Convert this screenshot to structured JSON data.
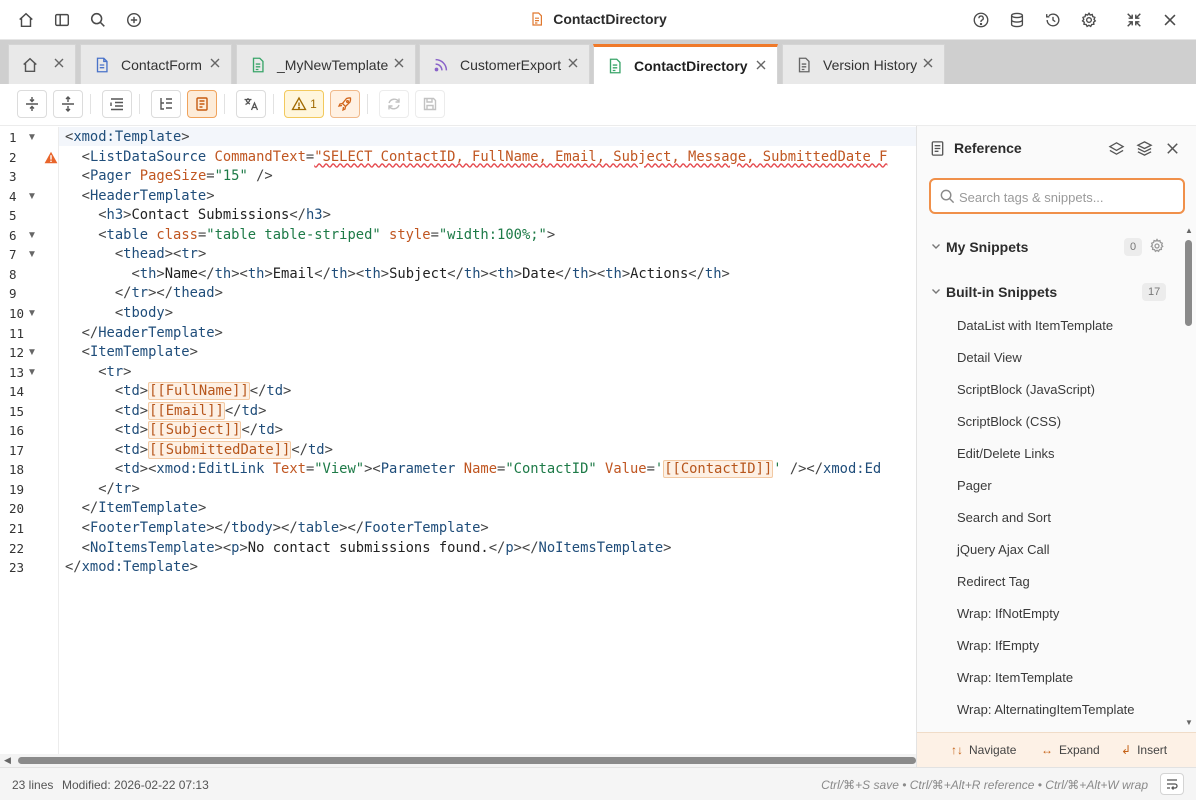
{
  "window": {
    "title": "ContactDirectory"
  },
  "tabs": [
    {
      "label": "",
      "icon": "home-icon"
    },
    {
      "label": "ContactForm",
      "icon": "document-icon"
    },
    {
      "label": "_MyNewTemplate",
      "icon": "template-icon"
    },
    {
      "label": "CustomerExport",
      "icon": "rss-icon"
    },
    {
      "label": "ContactDirectory",
      "icon": "template-icon",
      "active": true
    },
    {
      "label": "Version History",
      "icon": "history-document-icon"
    }
  ],
  "toolbar": {
    "warning_count": "1"
  },
  "editor": {
    "line_numbers": [
      "1",
      "2",
      "3",
      "4",
      "5",
      "6",
      "7",
      "8",
      "9",
      "10",
      "11",
      "12",
      "13",
      "14",
      "15",
      "16",
      "17",
      "18",
      "19",
      "20",
      "21",
      "22",
      "23"
    ],
    "foldable_lines": [
      1,
      4,
      6,
      7,
      10,
      12,
      13
    ],
    "warning_line": 2,
    "lines": [
      [
        [
          "br",
          "<"
        ],
        [
          "tag",
          "xmod:Template"
        ],
        [
          "br",
          ">"
        ]
      ],
      [
        [
          "txt",
          "  "
        ],
        [
          "br",
          "<"
        ],
        [
          "tag",
          "ListDataSource"
        ],
        [
          "txt",
          " "
        ],
        [
          "attr",
          "CommandText"
        ],
        [
          "br",
          "="
        ],
        [
          "sq",
          "\"SELECT ContactID, FullName, Email, Subject, Message, SubmittedDate F"
        ]
      ],
      [
        [
          "txt",
          "  "
        ],
        [
          "br",
          "<"
        ],
        [
          "tag",
          "Pager"
        ],
        [
          "txt",
          " "
        ],
        [
          "attr",
          "PageSize"
        ],
        [
          "br",
          "="
        ],
        [
          "str",
          "\"15\""
        ],
        [
          "txt",
          " "
        ],
        [
          "br",
          "/>"
        ]
      ],
      [
        [
          "txt",
          "  "
        ],
        [
          "br",
          "<"
        ],
        [
          "tag",
          "HeaderTemplate"
        ],
        [
          "br",
          ">"
        ]
      ],
      [
        [
          "txt",
          "    "
        ],
        [
          "br",
          "<"
        ],
        [
          "tag",
          "h3"
        ],
        [
          "br",
          ">"
        ],
        [
          "txt",
          "Contact Submissions"
        ],
        [
          "br",
          "</"
        ],
        [
          "tag",
          "h3"
        ],
        [
          "br",
          ">"
        ]
      ],
      [
        [
          "txt",
          "    "
        ],
        [
          "br",
          "<"
        ],
        [
          "tag",
          "table"
        ],
        [
          "txt",
          " "
        ],
        [
          "attr",
          "class"
        ],
        [
          "br",
          "="
        ],
        [
          "str",
          "\"table table-striped\""
        ],
        [
          "txt",
          " "
        ],
        [
          "attr",
          "style"
        ],
        [
          "br",
          "="
        ],
        [
          "str",
          "\"width:100%;\""
        ],
        [
          "br",
          ">"
        ]
      ],
      [
        [
          "txt",
          "      "
        ],
        [
          "br",
          "<"
        ],
        [
          "tag",
          "thead"
        ],
        [
          "br",
          "><"
        ],
        [
          "tag",
          "tr"
        ],
        [
          "br",
          ">"
        ]
      ],
      [
        [
          "txt",
          "        "
        ],
        [
          "br",
          "<"
        ],
        [
          "tag",
          "th"
        ],
        [
          "br",
          ">"
        ],
        [
          "txt",
          "Name"
        ],
        [
          "br",
          "</"
        ],
        [
          "tag",
          "th"
        ],
        [
          "br",
          "><"
        ],
        [
          "tag",
          "th"
        ],
        [
          "br",
          ">"
        ],
        [
          "txt",
          "Email"
        ],
        [
          "br",
          "</"
        ],
        [
          "tag",
          "th"
        ],
        [
          "br",
          "><"
        ],
        [
          "tag",
          "th"
        ],
        [
          "br",
          ">"
        ],
        [
          "txt",
          "Subject"
        ],
        [
          "br",
          "</"
        ],
        [
          "tag",
          "th"
        ],
        [
          "br",
          "><"
        ],
        [
          "tag",
          "th"
        ],
        [
          "br",
          ">"
        ],
        [
          "txt",
          "Date"
        ],
        [
          "br",
          "</"
        ],
        [
          "tag",
          "th"
        ],
        [
          "br",
          "><"
        ],
        [
          "tag",
          "th"
        ],
        [
          "br",
          ">"
        ],
        [
          "txt",
          "Actions"
        ],
        [
          "br",
          "</"
        ],
        [
          "tag",
          "th"
        ],
        [
          "br",
          ">"
        ]
      ],
      [
        [
          "txt",
          "      "
        ],
        [
          "br",
          "</"
        ],
        [
          "tag",
          "tr"
        ],
        [
          "br",
          "></"
        ],
        [
          "tag",
          "thead"
        ],
        [
          "br",
          ">"
        ]
      ],
      [
        [
          "txt",
          "      "
        ],
        [
          "br",
          "<"
        ],
        [
          "tag",
          "tbody"
        ],
        [
          "br",
          ">"
        ]
      ],
      [
        [
          "txt",
          "  "
        ],
        [
          "br",
          "</"
        ],
        [
          "tag",
          "HeaderTemplate"
        ],
        [
          "br",
          ">"
        ]
      ],
      [
        [
          "txt",
          "  "
        ],
        [
          "br",
          "<"
        ],
        [
          "tag",
          "ItemTemplate"
        ],
        [
          "br",
          ">"
        ]
      ],
      [
        [
          "txt",
          "    "
        ],
        [
          "br",
          "<"
        ],
        [
          "tag",
          "tr"
        ],
        [
          "br",
          ">"
        ]
      ],
      [
        [
          "txt",
          "      "
        ],
        [
          "br",
          "<"
        ],
        [
          "tag",
          "td"
        ],
        [
          "br",
          ">"
        ],
        [
          "tok",
          "[[FullName]]"
        ],
        [
          "br",
          "</"
        ],
        [
          "tag",
          "td"
        ],
        [
          "br",
          ">"
        ]
      ],
      [
        [
          "txt",
          "      "
        ],
        [
          "br",
          "<"
        ],
        [
          "tag",
          "td"
        ],
        [
          "br",
          ">"
        ],
        [
          "tok",
          "[[Email]]"
        ],
        [
          "br",
          "</"
        ],
        [
          "tag",
          "td"
        ],
        [
          "br",
          ">"
        ]
      ],
      [
        [
          "txt",
          "      "
        ],
        [
          "br",
          "<"
        ],
        [
          "tag",
          "td"
        ],
        [
          "br",
          ">"
        ],
        [
          "tok",
          "[[Subject]]"
        ],
        [
          "br",
          "</"
        ],
        [
          "tag",
          "td"
        ],
        [
          "br",
          ">"
        ]
      ],
      [
        [
          "txt",
          "      "
        ],
        [
          "br",
          "<"
        ],
        [
          "tag",
          "td"
        ],
        [
          "br",
          ">"
        ],
        [
          "tok",
          "[[SubmittedDate]]"
        ],
        [
          "br",
          "</"
        ],
        [
          "tag",
          "td"
        ],
        [
          "br",
          ">"
        ]
      ],
      [
        [
          "txt",
          "      "
        ],
        [
          "br",
          "<"
        ],
        [
          "tag",
          "td"
        ],
        [
          "br",
          "><"
        ],
        [
          "tag",
          "xmod:EditLink"
        ],
        [
          "txt",
          " "
        ],
        [
          "attr",
          "Text"
        ],
        [
          "br",
          "="
        ],
        [
          "str",
          "\"View\""
        ],
        [
          "br",
          "><"
        ],
        [
          "tag",
          "Parameter"
        ],
        [
          "txt",
          " "
        ],
        [
          "attr",
          "Name"
        ],
        [
          "br",
          "="
        ],
        [
          "str",
          "\"ContactID\""
        ],
        [
          "txt",
          " "
        ],
        [
          "attr",
          "Value"
        ],
        [
          "br",
          "="
        ],
        [
          "str",
          "'"
        ],
        [
          "tok",
          "[[ContactID]]"
        ],
        [
          "str",
          "'"
        ],
        [
          "txt",
          " "
        ],
        [
          "br",
          "/></"
        ],
        [
          "tag",
          "xmod:Ed"
        ]
      ],
      [
        [
          "txt",
          "    "
        ],
        [
          "br",
          "</"
        ],
        [
          "tag",
          "tr"
        ],
        [
          "br",
          ">"
        ]
      ],
      [
        [
          "txt",
          "  "
        ],
        [
          "br",
          "</"
        ],
        [
          "tag",
          "ItemTemplate"
        ],
        [
          "br",
          ">"
        ]
      ],
      [
        [
          "txt",
          "  "
        ],
        [
          "br",
          "<"
        ],
        [
          "tag",
          "FooterTemplate"
        ],
        [
          "br",
          "></"
        ],
        [
          "tag",
          "tbody"
        ],
        [
          "br",
          "></"
        ],
        [
          "tag",
          "table"
        ],
        [
          "br",
          "></"
        ],
        [
          "tag",
          "FooterTemplate"
        ],
        [
          "br",
          ">"
        ]
      ],
      [
        [
          "txt",
          "  "
        ],
        [
          "br",
          "<"
        ],
        [
          "tag",
          "NoItemsTemplate"
        ],
        [
          "br",
          "><"
        ],
        [
          "tag",
          "p"
        ],
        [
          "br",
          ">"
        ],
        [
          "txt",
          "No contact submissions found."
        ],
        [
          "br",
          "</"
        ],
        [
          "tag",
          "p"
        ],
        [
          "br",
          "></"
        ],
        [
          "tag",
          "NoItemsTemplate"
        ],
        [
          "br",
          ">"
        ]
      ],
      [
        [
          "br",
          "</"
        ],
        [
          "tag",
          "xmod:Template"
        ],
        [
          "br",
          ">"
        ]
      ]
    ]
  },
  "reference": {
    "title": "Reference",
    "search_placeholder": "Search tags & snippets...",
    "my_snippets": {
      "label": "My Snippets",
      "count": "0"
    },
    "builtin": {
      "label": "Built-in Snippets",
      "count": "17",
      "items": [
        "DataList with ItemTemplate",
        "Detail View",
        "ScriptBlock (JavaScript)",
        "ScriptBlock (CSS)",
        "Edit/Delete Links",
        "Pager",
        "Search and Sort",
        "jQuery Ajax Call",
        "Redirect Tag",
        "Wrap: IfNotEmpty",
        "Wrap: IfEmpty",
        "Wrap: ItemTemplate",
        "Wrap: AlternatingItemTemplate"
      ]
    },
    "footer": {
      "navigate_key": "↑↓",
      "navigate_label": "Navigate",
      "expand_key": "↔",
      "expand_label": "Expand",
      "insert_key": "↲",
      "insert_label": "Insert"
    }
  },
  "status": {
    "lines": "23 lines",
    "modified": "Modified: 2026-02-22 07:13",
    "shortcuts": "Ctrl/⌘+S save • Ctrl/⌘+Alt+R reference • Ctrl/⌘+Alt+W wrap"
  },
  "colors": {
    "accent": "#f07a2a",
    "tag": "#1f4d7a",
    "attribute": "#c05621",
    "string": "#1d7a47"
  }
}
